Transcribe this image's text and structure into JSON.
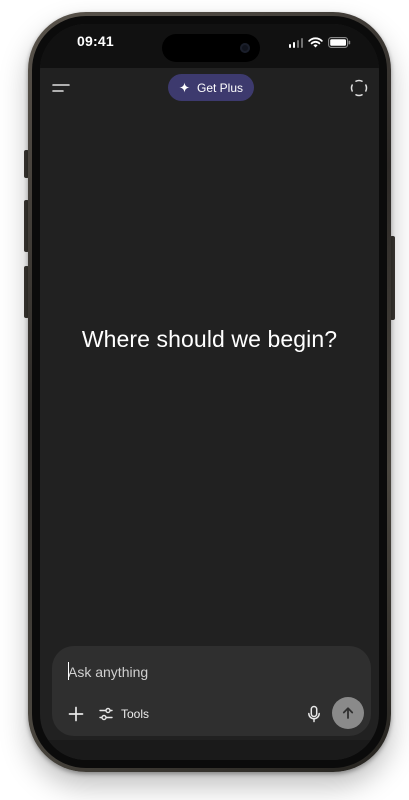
{
  "status_bar": {
    "time": "09:41",
    "icons": [
      "signal-icon",
      "wifi-icon",
      "battery-icon"
    ]
  },
  "header": {
    "menu_icon": "menu-icon",
    "upgrade_label": "Get Plus",
    "upgrade_icon": "sparkle-icon",
    "new_chat_icon": "new-chat-icon"
  },
  "main": {
    "headline": "Where should we begin?"
  },
  "composer": {
    "placeholder": "Ask anything",
    "value": "",
    "plus_icon": "plus-icon",
    "tools_label": "Tools",
    "tools_icon": "sliders-icon",
    "mic_icon": "mic-icon",
    "send_icon": "arrow-up-icon"
  },
  "colors": {
    "screen_bg": "#212121",
    "status_bg": "#111111",
    "accent_pill": "#3d3a6e",
    "composer_bg": "#2f2f2f",
    "send_button": "#8a8a8a"
  }
}
